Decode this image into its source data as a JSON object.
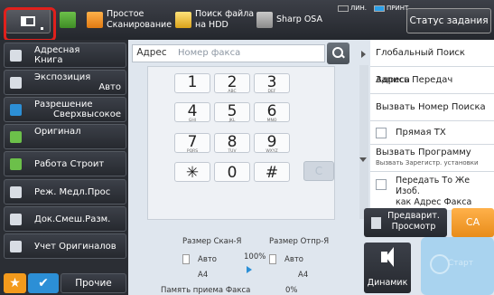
{
  "topbar": {
    "shortcuts": [
      {
        "label_line1": "",
        "label_line2": ""
      },
      {
        "label_line1": "Простое",
        "label_line2": "Сканирование"
      },
      {
        "label_line1": "Поиск файла",
        "label_line2": "на HDD"
      },
      {
        "label_line1": "Sharp OSA",
        "label_line2": ""
      }
    ],
    "indicator_line": "ЛИН.",
    "indicator_print": "ПРИНТ",
    "job_status": "Статус задания"
  },
  "left_menu": {
    "address_book_line1": "Адресная",
    "address_book_line2": "Книга",
    "exposure": "Экспозиция",
    "exposure_value": "Авто",
    "resolution": "Разрешение",
    "resolution_value": "Сверхвысокое",
    "original": "Оригинал",
    "job_build": "Работа Строит",
    "slow_scan": "Реж. Медл.Прос",
    "mixed_size": "Док.Смеш.Разм.",
    "count_originals": "Учет Оригиналов",
    "others": "Прочие"
  },
  "address": {
    "label": "Адрес",
    "placeholder": "Номер факса"
  },
  "keypad": [
    {
      "num": "1",
      "sub": ""
    },
    {
      "num": "2",
      "sub": "ABC"
    },
    {
      "num": "3",
      "sub": "DEF"
    },
    {
      "num": "4",
      "sub": "GHI"
    },
    {
      "num": "5",
      "sub": "JKL"
    },
    {
      "num": "6",
      "sub": "MNO"
    },
    {
      "num": "7",
      "sub": "PQRS"
    },
    {
      "num": "8",
      "sub": "TUV"
    },
    {
      "num": "9",
      "sub": "WXYZ"
    },
    {
      "num": "✳",
      "sub": ""
    },
    {
      "num": "0",
      "sub": ""
    },
    {
      "num": "#",
      "sub": ""
    }
  ],
  "clear_label": "C",
  "right_panel": {
    "global_search": "Глобальный Поиск Адреса",
    "tx_log": "Запись Передач",
    "call_search_number": "Вызвать Номер Поиска",
    "direct_tx": "Прямая ТХ",
    "call_program": "Вызвать Программу",
    "call_program_sub": "Вызвать Зарегистр. установки",
    "send_same_line1": "Передать То Же Изоб.",
    "send_same_line2": "как Адрес Факса"
  },
  "status": {
    "scan_size_label": "Размер Скан-Я",
    "send_size_label": "Размер Отпр-Я",
    "scan_size_value": "Авто",
    "scan_paper": "A4",
    "ratio": "100%",
    "send_size_value": "Авто",
    "send_paper": "A4",
    "memory_label": "Память приема Факса",
    "memory_value": "0%"
  },
  "actions": {
    "preview_line1": "Предварит.",
    "preview_line2": "Просмотр",
    "ca": "CA",
    "speaker": "Динамик",
    "start": "Старт"
  }
}
